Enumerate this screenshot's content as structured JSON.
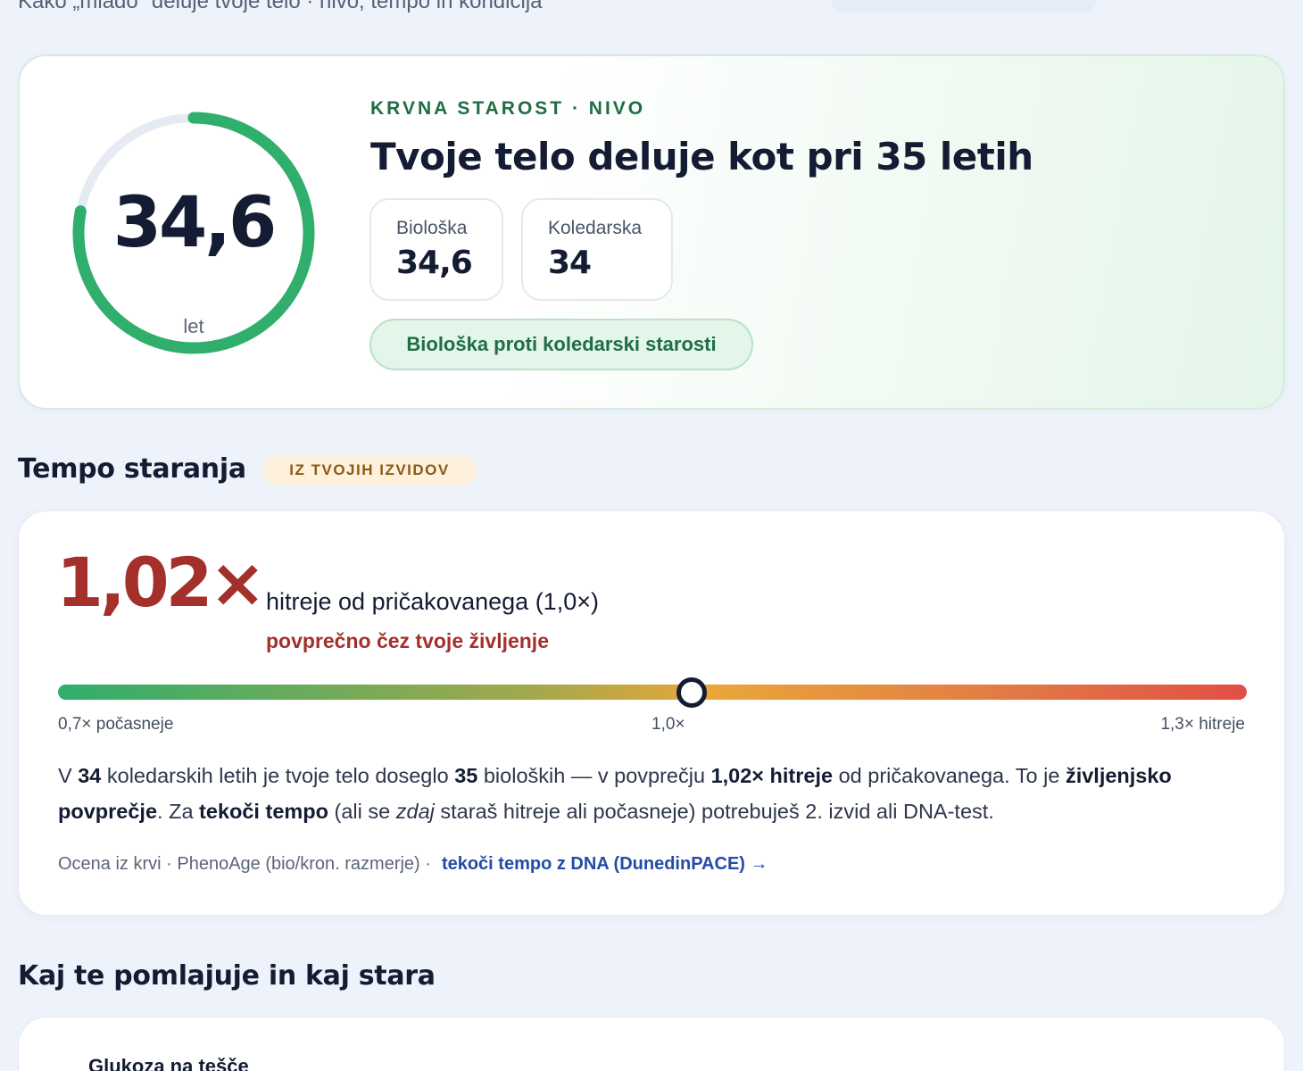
{
  "page": {
    "subtitle": "Kako „mlado\" deluje tvoje telo · nivo, tempo in kondicija"
  },
  "hero": {
    "ring_value": "34,6",
    "ring_unit": "let",
    "ring_fraction": 0.78,
    "eyebrow": "KRVNA STAROST · NIVO",
    "title": "Tvoje telo deluje kot pri 35 letih",
    "stats": [
      {
        "label": "Biološka",
        "value": "34,6"
      },
      {
        "label": "Koledarska",
        "value": "34"
      }
    ],
    "pill_label": "Biološka proti koledarski starosti",
    "colors": {
      "ring": "#2fae6c",
      "ring_track": "#e6ebf3",
      "accent_green": "#1f6e43"
    }
  },
  "tempo_section": {
    "title": "Tempo staranja",
    "badge": "IZ TVOJIH IZVIDOV"
  },
  "tempo": {
    "value": "1,02×",
    "description": "hitreje od pričakovanega (1,0×)",
    "sub": "povprečno čez tvoje življenje",
    "slider": {
      "min": 0.7,
      "max": 1.3,
      "value": 1.02,
      "left_label": "0,7× počasneje",
      "mid_label": "1,0×",
      "right_label": "1,3× hitreje"
    },
    "paragraph": {
      "p1": "V ",
      "b1": "34",
      "p2": " koledarskih letih je tvoje telo doseglo ",
      "b2": "35",
      "p3": " bioloških — v povprečju ",
      "b3": "1,02× hitreje",
      "p4": " od pričakovanega. To je ",
      "b4": "življenjsko povprečje",
      "p5": ". Za ",
      "b5": "tekoči tempo",
      "p6": " (ali se ",
      "i1": "zdaj",
      "p7": " staraš hitreje ali počasneje) potrebuješ 2. izvid ali DNA-test."
    },
    "footnote": "Ocena iz krvi · PhenoAge (bio/kron. razmerje) ·",
    "footnote_link": "tekoči tempo z DNA (DunedinPACE) →",
    "colors": {
      "value": "#a3302b",
      "link": "#244ba6"
    }
  },
  "factors_section": {
    "title": "Kaj te pomlajuje in kaj stara",
    "first_item": "Glukoza na tešče"
  }
}
